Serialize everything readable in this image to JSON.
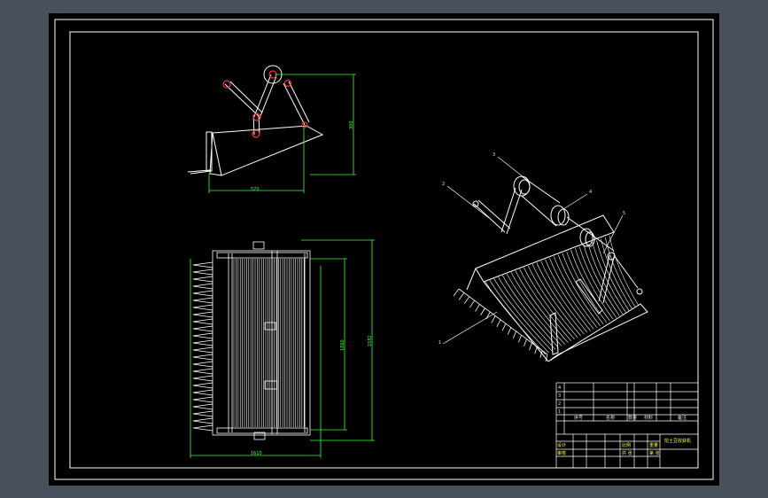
{
  "colors": {
    "background": "#48505c",
    "paper": "#000000",
    "frame": "#ffffff",
    "dimension": "#3cff3c",
    "annotation_yellow": "#ffff40",
    "pivot_red": "#ff3030"
  },
  "side_view": {
    "width_dim": "570",
    "height_dim": "300"
  },
  "plan_view": {
    "width_dim": "1610",
    "inner_height_dim": "1860",
    "outer_height_dim": "1582"
  },
  "iso_view": {
    "balloons": [
      "1",
      "2",
      "3",
      "4",
      "5"
    ]
  },
  "title_block": {
    "rows": [
      "1",
      "2",
      "3",
      "4"
    ],
    "col_labels": [
      "序号",
      "名称",
      "数量",
      "材料",
      "备注"
    ],
    "drawing_title": "挖土豆收获机",
    "footer_cells": [
      "设计",
      "审核",
      "比例",
      "重量",
      "共 张",
      "第 张"
    ]
  }
}
